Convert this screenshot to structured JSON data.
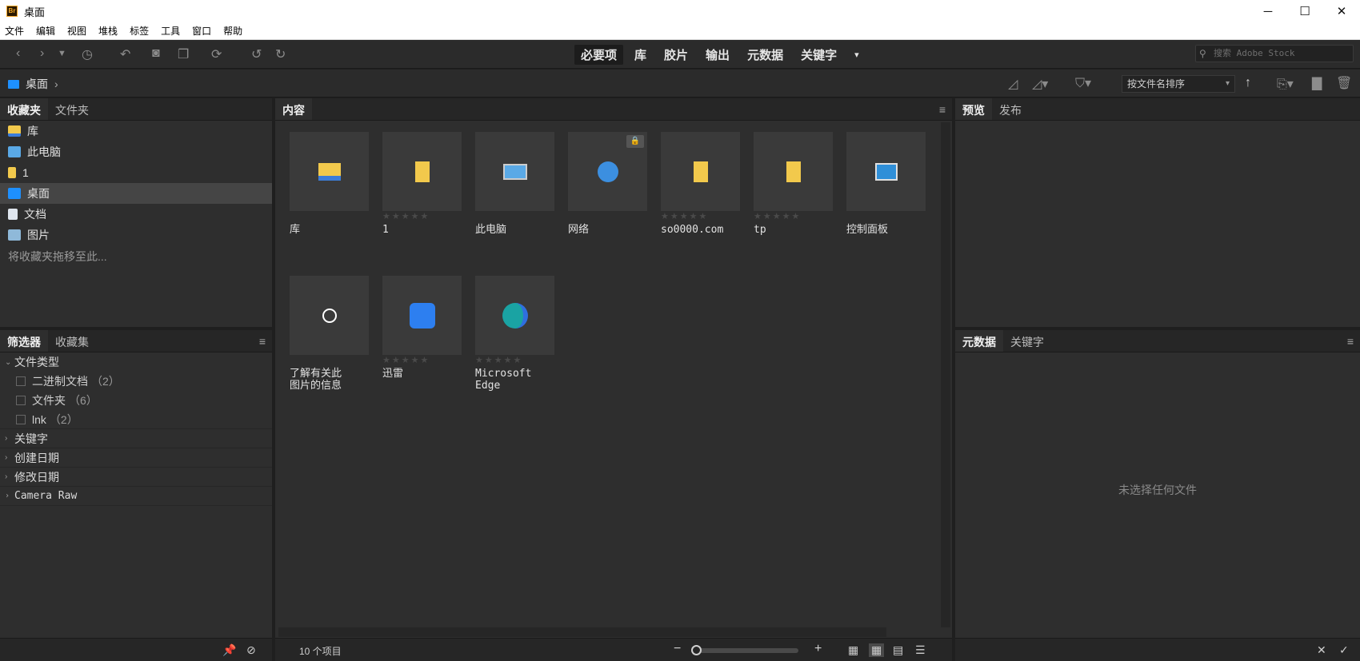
{
  "window": {
    "title": "桌面",
    "app_badge": "Br",
    "min": "─",
    "max": "☐",
    "close": "✕"
  },
  "menu": [
    "文件",
    "编辑",
    "视图",
    "堆栈",
    "标签",
    "工具",
    "窗口",
    "帮助"
  ],
  "workspaces": [
    "必要项",
    "库",
    "胶片",
    "输出",
    "元数据",
    "关键字"
  ],
  "search": {
    "placeholder": "搜索 Adobe Stock"
  },
  "path": {
    "current": "桌面",
    "separator": "›"
  },
  "sort": {
    "label": "按文件名排序"
  },
  "left_top": {
    "tabs": [
      "收藏夹",
      "文件夹"
    ],
    "items": [
      {
        "label": "库",
        "icon": "library-folder-icon"
      },
      {
        "label": "此电脑",
        "icon": "computer-icon"
      },
      {
        "label": "1",
        "icon": "folder-icon"
      },
      {
        "label": "桌面",
        "icon": "desktop-folder-icon",
        "selected": true
      },
      {
        "label": "文档",
        "icon": "document-icon"
      },
      {
        "label": "图片",
        "icon": "pictures-icon"
      }
    ],
    "hint": "将收藏夹拖移至此..."
  },
  "left_bottom": {
    "tabs": [
      "筛选器",
      "收藏集"
    ],
    "file_type": "文件类型",
    "file_types": [
      {
        "label": "二进制文档",
        "count": "（2）"
      },
      {
        "label": "文件夹",
        "count": "（6）"
      },
      {
        "label": "lnk",
        "count": "（2）"
      }
    ],
    "groups": [
      "关键字",
      "创建日期",
      "修改日期",
      "Camera Raw"
    ]
  },
  "content": {
    "tab": "内容",
    "items": [
      {
        "name": "库",
        "icon": "library-folder-icon",
        "stars": ""
      },
      {
        "name": "1",
        "icon": "folder-icon",
        "stars": "★★★★★"
      },
      {
        "name": "此电脑",
        "icon": "computer-icon",
        "stars": ""
      },
      {
        "name": "网络",
        "icon": "network-icon",
        "stars": "",
        "locked": true
      },
      {
        "name": "so0000.com",
        "icon": "folder-icon",
        "stars": "★★★★★"
      },
      {
        "name": "tp",
        "icon": "folder-icon",
        "stars": "★★★★★"
      },
      {
        "name": "控制面板",
        "icon": "control-panel-icon",
        "stars": ""
      },
      {
        "name": "了解有关此\n图片的信息",
        "icon": "info-icon",
        "stars": ""
      },
      {
        "name": "迅雷",
        "icon": "thunder-app-icon",
        "stars": "★★★★★"
      },
      {
        "name": "Microsoft\nEdge",
        "icon": "edge-browser-icon",
        "stars": "★★★★★"
      }
    ],
    "status": "10 个项目"
  },
  "right_top": {
    "tabs": [
      "预览",
      "发布"
    ]
  },
  "right_bottom": {
    "tabs": [
      "元数据",
      "关键字"
    ],
    "empty": "未选择任何文件"
  },
  "colors": {
    "folder": "#f2c94c",
    "accent_blue": "#1e90ff",
    "panel": "#2e2e2e"
  }
}
